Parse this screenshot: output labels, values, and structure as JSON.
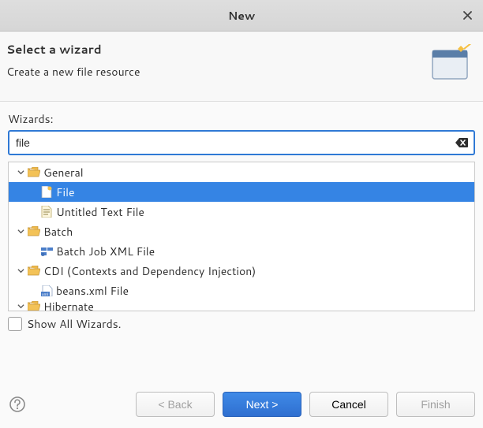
{
  "window": {
    "title": "New"
  },
  "header": {
    "title": "Select a wizard",
    "subtitle": "Create a new file resource"
  },
  "search": {
    "label": "Wizards:",
    "value": "file"
  },
  "tree": {
    "general": {
      "label": "General"
    },
    "file": {
      "label": "File"
    },
    "untitled": {
      "label": "Untitled Text File"
    },
    "batch": {
      "label": "Batch"
    },
    "batchjob": {
      "label": "Batch Job XML File"
    },
    "cdi": {
      "label": "CDI (Contexts and Dependency Injection)"
    },
    "beans": {
      "label": "beans.xml File"
    },
    "hibernate": {
      "label": "Hibernate"
    }
  },
  "show_all": {
    "label": "Show All Wizards."
  },
  "buttons": {
    "back": "< Back",
    "next": "Next >",
    "cancel": "Cancel",
    "finish": "Finish"
  }
}
